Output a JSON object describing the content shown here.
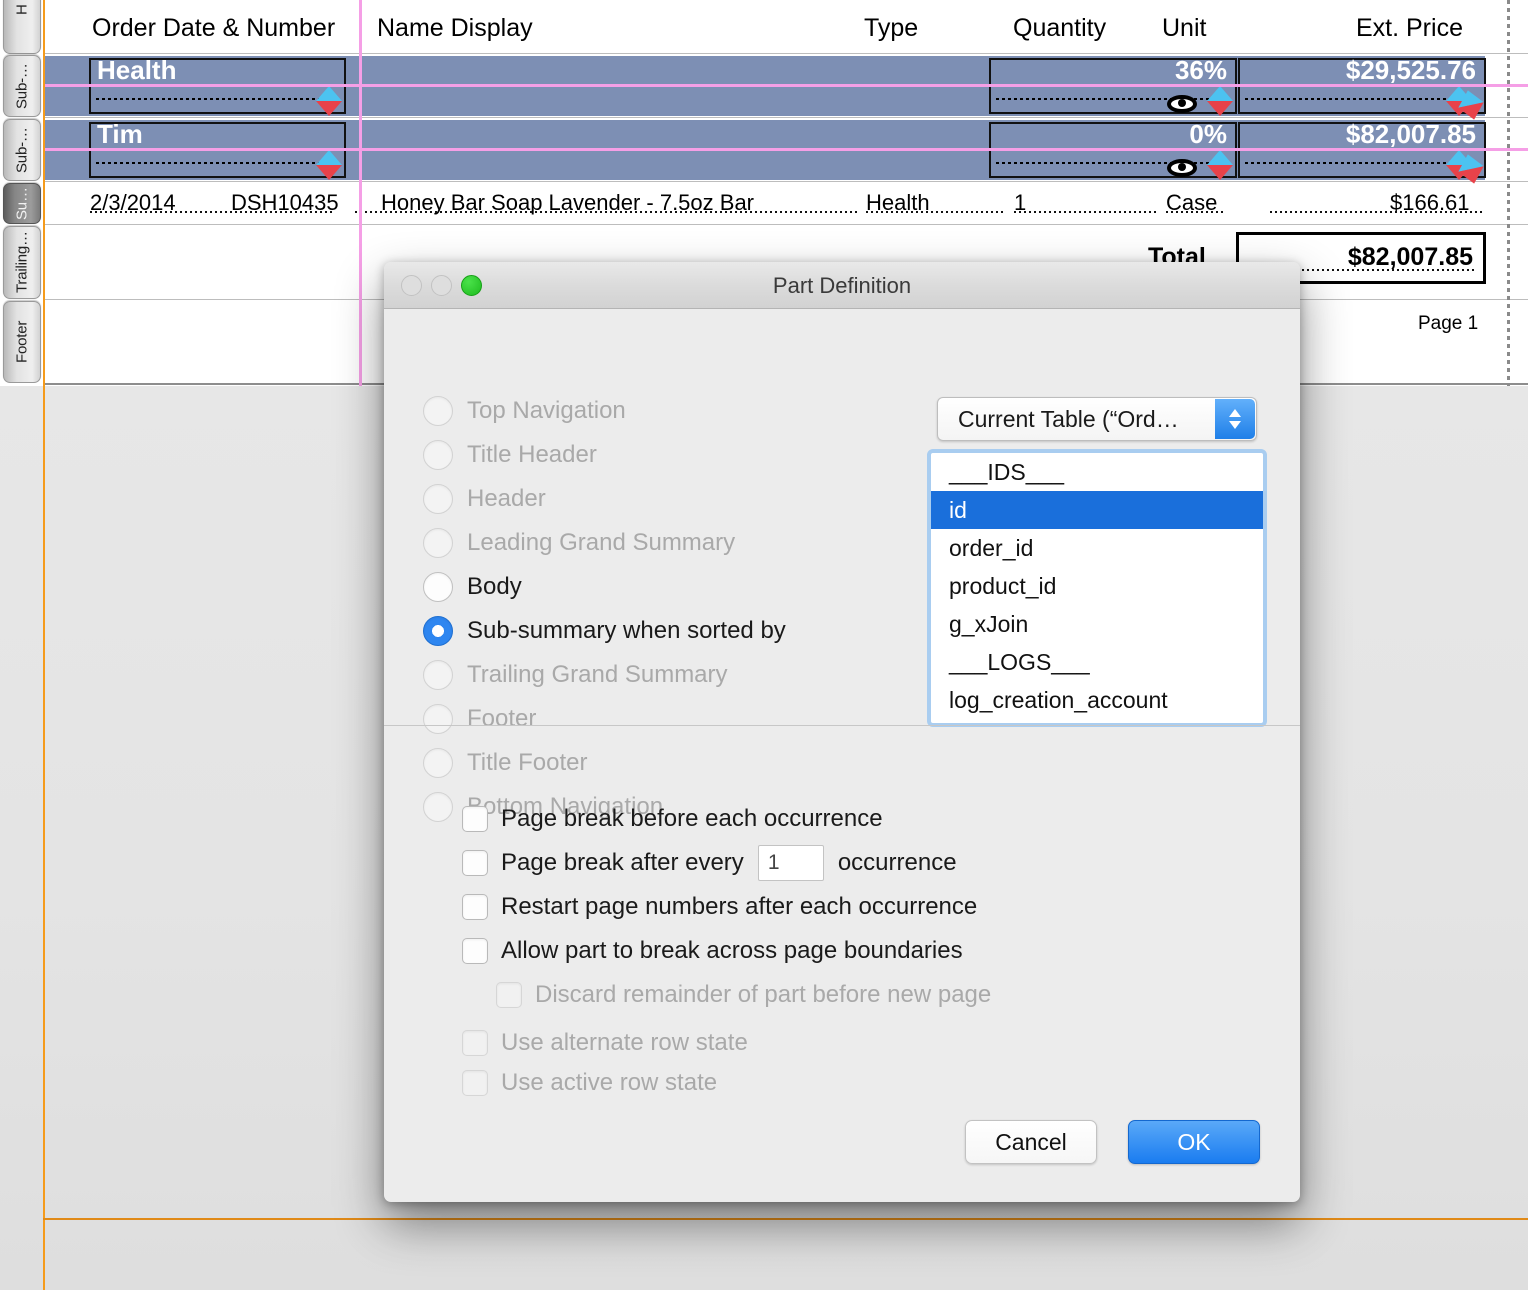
{
  "layout_canvas": {
    "part_labels": [
      {
        "text": "H",
        "selected": false
      },
      {
        "text": "Sub-…",
        "selected": false
      },
      {
        "text": "Sub-…",
        "selected": false
      },
      {
        "text": "Su…",
        "selected": true
      },
      {
        "text": "Trailing…",
        "selected": false
      },
      {
        "text": "Footer",
        "selected": false
      }
    ],
    "header_columns": [
      "Order Date & Number",
      "Name Display",
      "Type",
      "Quantity",
      "Unit",
      "Ext. Price"
    ],
    "subsummary_rows": [
      {
        "group_label": "Health",
        "percent": "36%",
        "amount": "$29,525.76"
      },
      {
        "group_label": "Tim",
        "percent": "0%",
        "amount": "$82,007.85"
      }
    ],
    "body_row": {
      "date": "2/3/2014",
      "order_number": "DSH10435",
      "name_display": "Honey Bar Soap Lavender - 7.5oz Bar",
      "type": "Health",
      "quantity": "1",
      "unit": "Case",
      "ext_price": "$166.61"
    },
    "grand_summary": {
      "label": "Total",
      "value": "$82,007.85"
    },
    "footer": {
      "page_number": "Page 1"
    },
    "colors": {
      "band": "#7d8fb4",
      "guide": "#f59fe6",
      "margin": "#f59b1c"
    }
  },
  "dialog": {
    "title": "Part Definition",
    "part_types": [
      {
        "label": "Top Navigation",
        "state": "disabled"
      },
      {
        "label": "Title Header",
        "state": "disabled"
      },
      {
        "label": "Header",
        "state": "disabled"
      },
      {
        "label": "Leading Grand Summary",
        "state": "disabled"
      },
      {
        "label": "Body",
        "state": "enabled"
      },
      {
        "label": "Sub-summary when sorted by",
        "state": "selected"
      },
      {
        "label": "Trailing Grand Summary",
        "state": "disabled"
      },
      {
        "label": "Footer",
        "state": "disabled"
      },
      {
        "label": "Title Footer",
        "state": "disabled"
      },
      {
        "label": "Bottom Navigation",
        "state": "disabled"
      }
    ],
    "table_popup": {
      "selected": "Current Table (“Ord…"
    },
    "field_list": [
      {
        "label": "___IDS___",
        "selected": false
      },
      {
        "label": "id",
        "selected": true
      },
      {
        "label": "order_id",
        "selected": false
      },
      {
        "label": "product_id",
        "selected": false
      },
      {
        "label": "g_xJoin",
        "selected": false
      },
      {
        "label": "___LOGS___",
        "selected": false
      },
      {
        "label": "log_creation_account",
        "selected": false
      }
    ],
    "options": [
      {
        "label": "Page break before each occurrence",
        "checked": false,
        "state": "enabled"
      },
      {
        "label": "Page break after every",
        "checked": false,
        "state": "enabled",
        "suffix": "occurrence",
        "value": "1"
      },
      {
        "label": "Restart page numbers after each occurrence",
        "checked": false,
        "state": "enabled"
      },
      {
        "label": "Allow part to break across page boundaries",
        "checked": false,
        "state": "enabled"
      },
      {
        "label": "Discard remainder of part before new page",
        "checked": false,
        "state": "disabled"
      },
      {
        "label": "Use alternate row state",
        "checked": false,
        "state": "disabled"
      },
      {
        "label": "Use active row state",
        "checked": false,
        "state": "disabled"
      }
    ],
    "buttons": {
      "cancel": "Cancel",
      "ok": "OK"
    }
  }
}
